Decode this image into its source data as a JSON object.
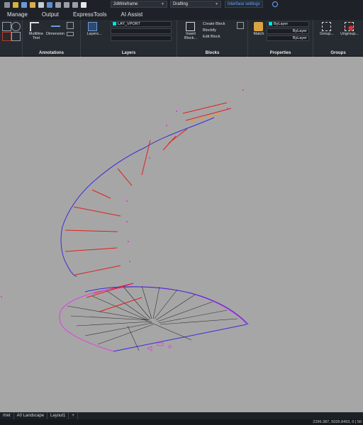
{
  "qat": {
    "visual_style": "2dWireframe",
    "workspace": "Drafting",
    "interface_settings": "Interface settings"
  },
  "menu": [
    "Manage",
    "Output",
    "ExpressTools",
    "AI Assist"
  ],
  "ribbon": {
    "annotations": {
      "title": "Annotations",
      "multiline_text": "Multiline\nText",
      "dimension": "Dimension"
    },
    "layers": {
      "title": "Layers",
      "layers_button": "Layers...",
      "current_layer": "LAY_VPORT"
    },
    "blocks": {
      "title": "Blocks",
      "insert_block": "Insert\nBlock...",
      "create_block": "Create Block",
      "blockify": "Blockify",
      "edit_block": "Edit Block"
    },
    "properties": {
      "title": "Properties",
      "match": "Match",
      "color": "ByLayer",
      "linetype": "ByLayer",
      "lineweight": "ByLayer"
    },
    "groups": {
      "title": "Groups",
      "group": "Group...",
      "ungroup": "Ungroup..."
    }
  },
  "tabs": [
    "rtret",
    "A0 Landscape",
    "Layout1",
    "+"
  ],
  "status": {
    "coords": "2296.387, 5035.8493, 0 | 50"
  },
  "colors": {
    "canvas_bg": "#a6a6a6",
    "ribbon_bg": "#262a31",
    "accent_blue": "#69a8ff",
    "layer_cyan": "#00e5e5"
  }
}
